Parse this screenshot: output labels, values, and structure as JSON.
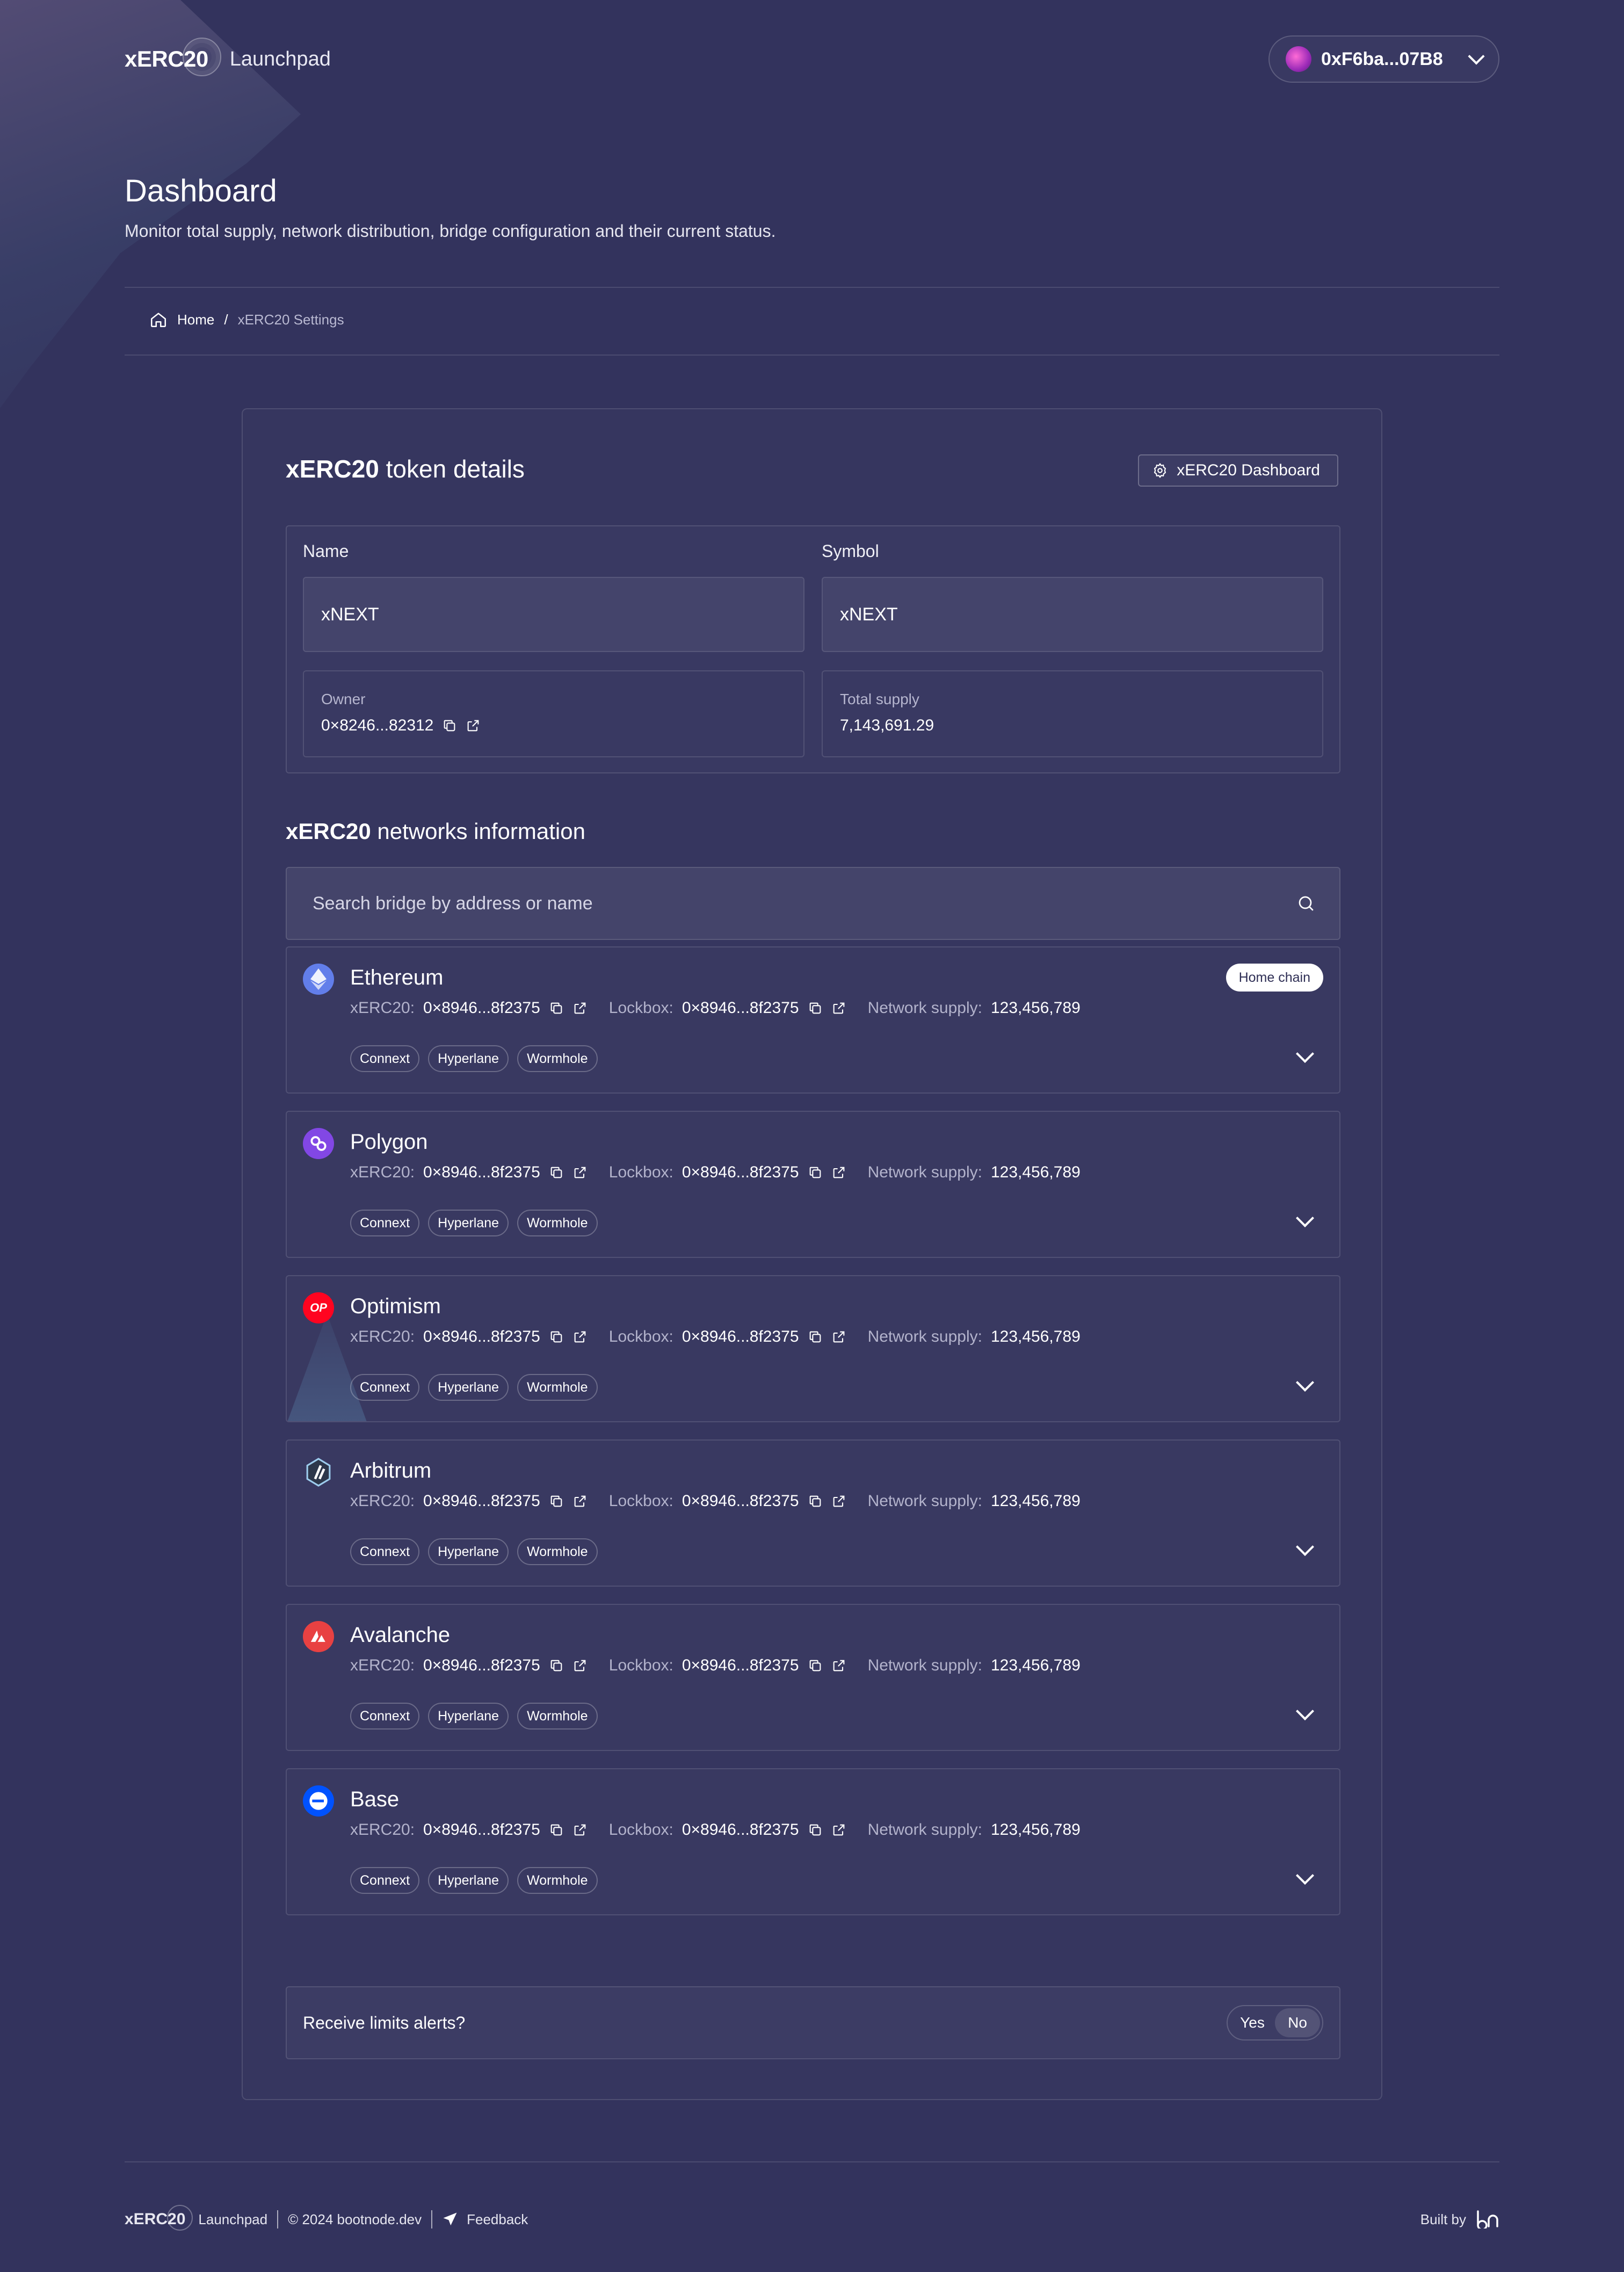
{
  "header": {
    "brand": "xERC20",
    "brand_sub": "Launchpad",
    "wallet_address": "0xF6ba...07B8"
  },
  "page": {
    "title": "Dashboard",
    "subtitle": "Monitor total supply, network distribution, bridge configuration and their current status."
  },
  "breadcrumb": {
    "home": "Home",
    "separator": "/",
    "current": "xERC20 Settings"
  },
  "token_details": {
    "title_bold": "xERC20",
    "title_rest": " token details",
    "dashboard_button": "xERC20 Dashboard",
    "name_label": "Name",
    "name_value": "xNEXT",
    "symbol_label": "Symbol",
    "symbol_value": "xNEXT",
    "owner_label": "Owner",
    "owner_value": "0×8246...82312",
    "supply_label": "Total supply",
    "supply_value": "7,143,691.29"
  },
  "networks": {
    "title_bold": "xERC20",
    "title_rest": " networks information",
    "search_placeholder": "Search bridge by address or name",
    "labels": {
      "xerc20": "xERC20:",
      "lockbox": "Lockbox:",
      "supply": "Network supply:"
    },
    "home_badge": "Home chain",
    "items": [
      {
        "name": "Ethereum",
        "xerc20": "0×8946...8f2375",
        "lockbox": "0×8946...8f2375",
        "supply": "123,456,789",
        "bridges": [
          "Connext",
          "Hyperlane",
          "Wormhole"
        ],
        "color": "#627eea"
      },
      {
        "name": "Polygon",
        "xerc20": "0×8946...8f2375",
        "lockbox": "0×8946...8f2375",
        "supply": "123,456,789",
        "bridges": [
          "Connext",
          "Hyperlane",
          "Wormhole"
        ],
        "color": "#8247e5"
      },
      {
        "name": "Optimism",
        "logo_text": "OP",
        "xerc20": "0×8946...8f2375",
        "lockbox": "0×8946...8f2375",
        "supply": "123,456,789",
        "bridges": [
          "Connext",
          "Hyperlane",
          "Wormhole"
        ],
        "color": "#ff0420"
      },
      {
        "name": "Arbitrum",
        "xerc20": "0×8946...8f2375",
        "lockbox": "0×8946...8f2375",
        "supply": "123,456,789",
        "bridges": [
          "Connext",
          "Hyperlane",
          "Wormhole"
        ],
        "color": "#213147"
      },
      {
        "name": "Avalanche",
        "xerc20": "0×8946...8f2375",
        "lockbox": "0×8946...8f2375",
        "supply": "123,456,789",
        "bridges": [
          "Connext",
          "Hyperlane",
          "Wormhole"
        ],
        "color": "#e84142"
      },
      {
        "name": "Base",
        "xerc20": "0×8946...8f2375",
        "lockbox": "0×8946...8f2375",
        "supply": "123,456,789",
        "bridges": [
          "Connext",
          "Hyperlane",
          "Wormhole"
        ],
        "color": "#0052ff"
      }
    ]
  },
  "alerts": {
    "label": "Receive limits alerts?",
    "yes": "Yes",
    "no": "No",
    "selected": "No"
  },
  "footer": {
    "brand": "xERC20",
    "brand_sub": "Launchpad",
    "copyright": "© 2024 bootnode.dev",
    "feedback": "Feedback",
    "built_by": "Built by"
  }
}
